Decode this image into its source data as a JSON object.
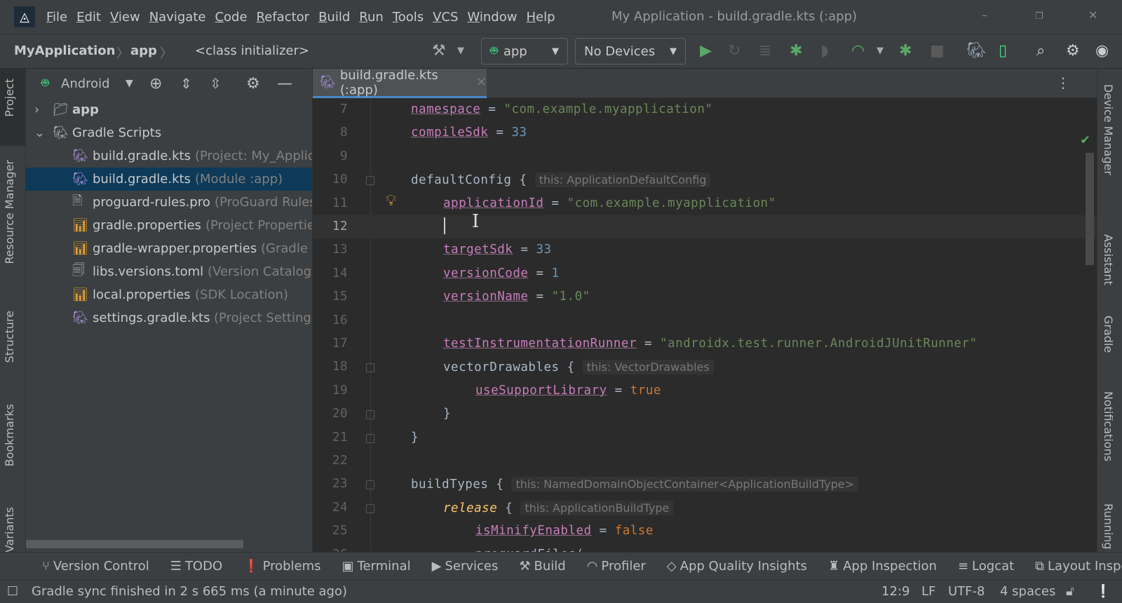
{
  "menubar": {
    "items": [
      "File",
      "Edit",
      "View",
      "Navigate",
      "Code",
      "Refactor",
      "Build",
      "Run",
      "Tools",
      "VCS",
      "Window",
      "Help"
    ],
    "window_title": "My Application - build.gradle.kts (:app)",
    "minimize": "–",
    "restore": "❐",
    "close": "✕"
  },
  "toolbar": {
    "breadcrumbs": [
      "MyApplication",
      "app",
      "<class initializer>"
    ],
    "run_config": "app",
    "device": "No Devices"
  },
  "left_stripe": [
    "Project",
    "Resource Manager",
    "Structure",
    "Bookmarks",
    "Variants"
  ],
  "right_stripe": [
    "Device Manager",
    "Assistant",
    "Gradle",
    "Notifications",
    "Running"
  ],
  "project": {
    "view": "Android",
    "tree": [
      {
        "name": "app",
        "hint": "",
        "level": 0,
        "expanded": false,
        "icon": "module-folder-icon"
      },
      {
        "name": "Gradle Scripts",
        "hint": "",
        "level": 0,
        "expanded": true,
        "icon": "gradle-icon"
      },
      {
        "name": "build.gradle.kts",
        "hint": "(Project: My_Application)",
        "level": 1,
        "icon": "gradle-kts-icon"
      },
      {
        "name": "build.gradle.kts",
        "hint": "(Module :app)",
        "level": 1,
        "icon": "gradle-kts-icon",
        "selected": true
      },
      {
        "name": "proguard-rules.pro",
        "hint": "(ProGuard Rules for \":app\")",
        "level": 1,
        "icon": "text-file-icon"
      },
      {
        "name": "gradle.properties",
        "hint": "(Project Properties)",
        "level": 1,
        "icon": "properties-icon"
      },
      {
        "name": "gradle-wrapper.properties",
        "hint": "(Gradle Version)",
        "level": 1,
        "icon": "properties-icon"
      },
      {
        "name": "libs.versions.toml",
        "hint": "(Version Catalog)",
        "level": 1,
        "icon": "toml-icon"
      },
      {
        "name": "local.properties",
        "hint": "(SDK Location)",
        "level": 1,
        "icon": "properties-icon"
      },
      {
        "name": "settings.gradle.kts",
        "hint": "(Project Settings)",
        "level": 1,
        "icon": "gradle-kts-icon"
      }
    ]
  },
  "editor": {
    "tab": "build.gradle.kts (:app)",
    "current_line": 12,
    "lines": [
      {
        "n": "7",
        "indent": 0,
        "tokens": [
          [
            "prop",
            "namespace"
          ],
          [
            "plain",
            " = "
          ],
          [
            "str",
            "\"com.example.myapplication\""
          ]
        ]
      },
      {
        "n": "8",
        "indent": 0,
        "tokens": [
          [
            "prop",
            "compileSdk"
          ],
          [
            "plain",
            " = "
          ],
          [
            "num",
            "33"
          ]
        ]
      },
      {
        "n": "9",
        "indent": 0,
        "tokens": []
      },
      {
        "n": "10",
        "indent": 0,
        "tokens": [
          [
            "plain",
            "defaultConfig { "
          ],
          [
            "hint",
            "this: ApplicationDefaultConfig"
          ]
        ]
      },
      {
        "n": "11",
        "indent": 1,
        "tokens": [
          [
            "prop",
            "applicationId"
          ],
          [
            "plain",
            " = "
          ],
          [
            "str",
            "\"com.example.myapplication\""
          ]
        ]
      },
      {
        "n": "12",
        "indent": 1,
        "tokens": []
      },
      {
        "n": "13",
        "indent": 1,
        "tokens": [
          [
            "prop",
            "targetSdk"
          ],
          [
            "plain",
            " = "
          ],
          [
            "num",
            "33"
          ]
        ]
      },
      {
        "n": "14",
        "indent": 1,
        "tokens": [
          [
            "prop",
            "versionCode"
          ],
          [
            "plain",
            " = "
          ],
          [
            "num",
            "1"
          ]
        ]
      },
      {
        "n": "15",
        "indent": 1,
        "tokens": [
          [
            "prop",
            "versionName"
          ],
          [
            "plain",
            " = "
          ],
          [
            "str",
            "\"1.0\""
          ]
        ]
      },
      {
        "n": "16",
        "indent": 1,
        "tokens": []
      },
      {
        "n": "17",
        "indent": 1,
        "tokens": [
          [
            "prop",
            "testInstrumentationRunner"
          ],
          [
            "plain",
            " = "
          ],
          [
            "str",
            "\"androidx.test.runner.AndroidJUnitRunner\""
          ]
        ]
      },
      {
        "n": "18",
        "indent": 1,
        "tokens": [
          [
            "plain",
            "vectorDrawables { "
          ],
          [
            "hint",
            "this: VectorDrawables"
          ]
        ]
      },
      {
        "n": "19",
        "indent": 2,
        "tokens": [
          [
            "prop",
            "useSupportLibrary"
          ],
          [
            "plain",
            " = "
          ],
          [
            "kw",
            "true"
          ]
        ]
      },
      {
        "n": "20",
        "indent": 1,
        "tokens": [
          [
            "plain",
            "}"
          ]
        ]
      },
      {
        "n": "21",
        "indent": 0,
        "tokens": [
          [
            "plain",
            "}"
          ]
        ]
      },
      {
        "n": "22",
        "indent": 0,
        "tokens": []
      },
      {
        "n": "23",
        "indent": 0,
        "tokens": [
          [
            "plain",
            "buildTypes { "
          ],
          [
            "hint",
            "this: NamedDomainObjectContainer<ApplicationBuildType>"
          ]
        ]
      },
      {
        "n": "24",
        "indent": 1,
        "tokens": [
          [
            "fn",
            "release"
          ],
          [
            "plain",
            " { "
          ],
          [
            "hint",
            "this: ApplicationBuildType"
          ]
        ]
      },
      {
        "n": "25",
        "indent": 2,
        "tokens": [
          [
            "prop",
            "isMinifyEnabled"
          ],
          [
            "plain",
            " = "
          ],
          [
            "kw",
            "false"
          ]
        ]
      },
      {
        "n": "26",
        "indent": 2,
        "tokens": [
          [
            "plain",
            "proguardFiles("
          ]
        ]
      }
    ]
  },
  "bottom_tools": [
    {
      "label": "Version Control",
      "icon": "version-control-icon",
      "glyph": "⑂"
    },
    {
      "label": "TODO",
      "icon": "todo-list-icon",
      "glyph": "☰"
    },
    {
      "label": "Problems",
      "icon": "problems-icon",
      "glyph": "❗"
    },
    {
      "label": "Terminal",
      "icon": "terminal-icon",
      "glyph": "▣"
    },
    {
      "label": "Services",
      "icon": "services-icon",
      "glyph": "▶"
    },
    {
      "label": "Build",
      "icon": "hammer-icon",
      "glyph": "⚒"
    },
    {
      "label": "Profiler",
      "icon": "profiler-icon",
      "glyph": "◠"
    },
    {
      "label": "App Quality Insights",
      "icon": "diamond-icon",
      "glyph": "◇"
    },
    {
      "label": "App Inspection",
      "icon": "app-inspection-icon",
      "glyph": "♜"
    },
    {
      "label": "Logcat",
      "icon": "logcat-icon",
      "glyph": "≡"
    },
    {
      "label": "Layout Inspector",
      "icon": "layout-inspector-icon",
      "glyph": "⧉"
    }
  ],
  "status": {
    "message": "Gradle sync finished in 2 s 665 ms (a minute ago)",
    "position": "12:9",
    "line_sep": "LF",
    "encoding": "UTF-8",
    "indent": "4 spaces"
  },
  "colors": {
    "accent": "#4a88c7",
    "run_green": "#59a869",
    "selection": "#0d3a58"
  }
}
